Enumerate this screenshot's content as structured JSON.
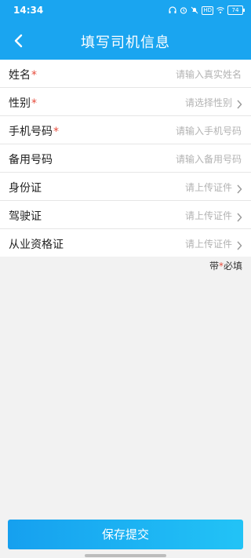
{
  "status_bar": {
    "time": "14:34",
    "battery": "74",
    "hd": "HD",
    "icons": [
      "headphones-icon",
      "alarm-icon",
      "mute-icon",
      "wifi-icon"
    ]
  },
  "header": {
    "title": "填写司机信息",
    "back_icon": "back-arrow-icon",
    "color": "#1aa5f0"
  },
  "form": {
    "rows": [
      {
        "label": "姓名",
        "required": "*",
        "placeholder": "请输入真实姓名",
        "has_arrow": false
      },
      {
        "label": "性别",
        "required": "*",
        "placeholder": "请选择性别",
        "has_arrow": true
      },
      {
        "label": "手机号码",
        "required": "*",
        "placeholder": "请输入手机号码",
        "has_arrow": false
      },
      {
        "label": "备用号码",
        "required": "",
        "placeholder": "请输入备用号码",
        "has_arrow": false
      },
      {
        "label": "身份证",
        "required": "",
        "placeholder": "请上传证件",
        "has_arrow": true
      },
      {
        "label": "驾驶证",
        "required": "",
        "placeholder": "请上传证件",
        "has_arrow": true
      },
      {
        "label": "从业资格证",
        "required": "",
        "placeholder": "请上传证件",
        "has_arrow": true
      }
    ]
  },
  "note": {
    "prefix": "带",
    "star": "*",
    "suffix": "必填"
  },
  "submit_button": {
    "label": "保存提交"
  },
  "colors": {
    "accent": "#1aa5f0",
    "required": "#e74c3c",
    "placeholder": "#b3b3b3"
  }
}
